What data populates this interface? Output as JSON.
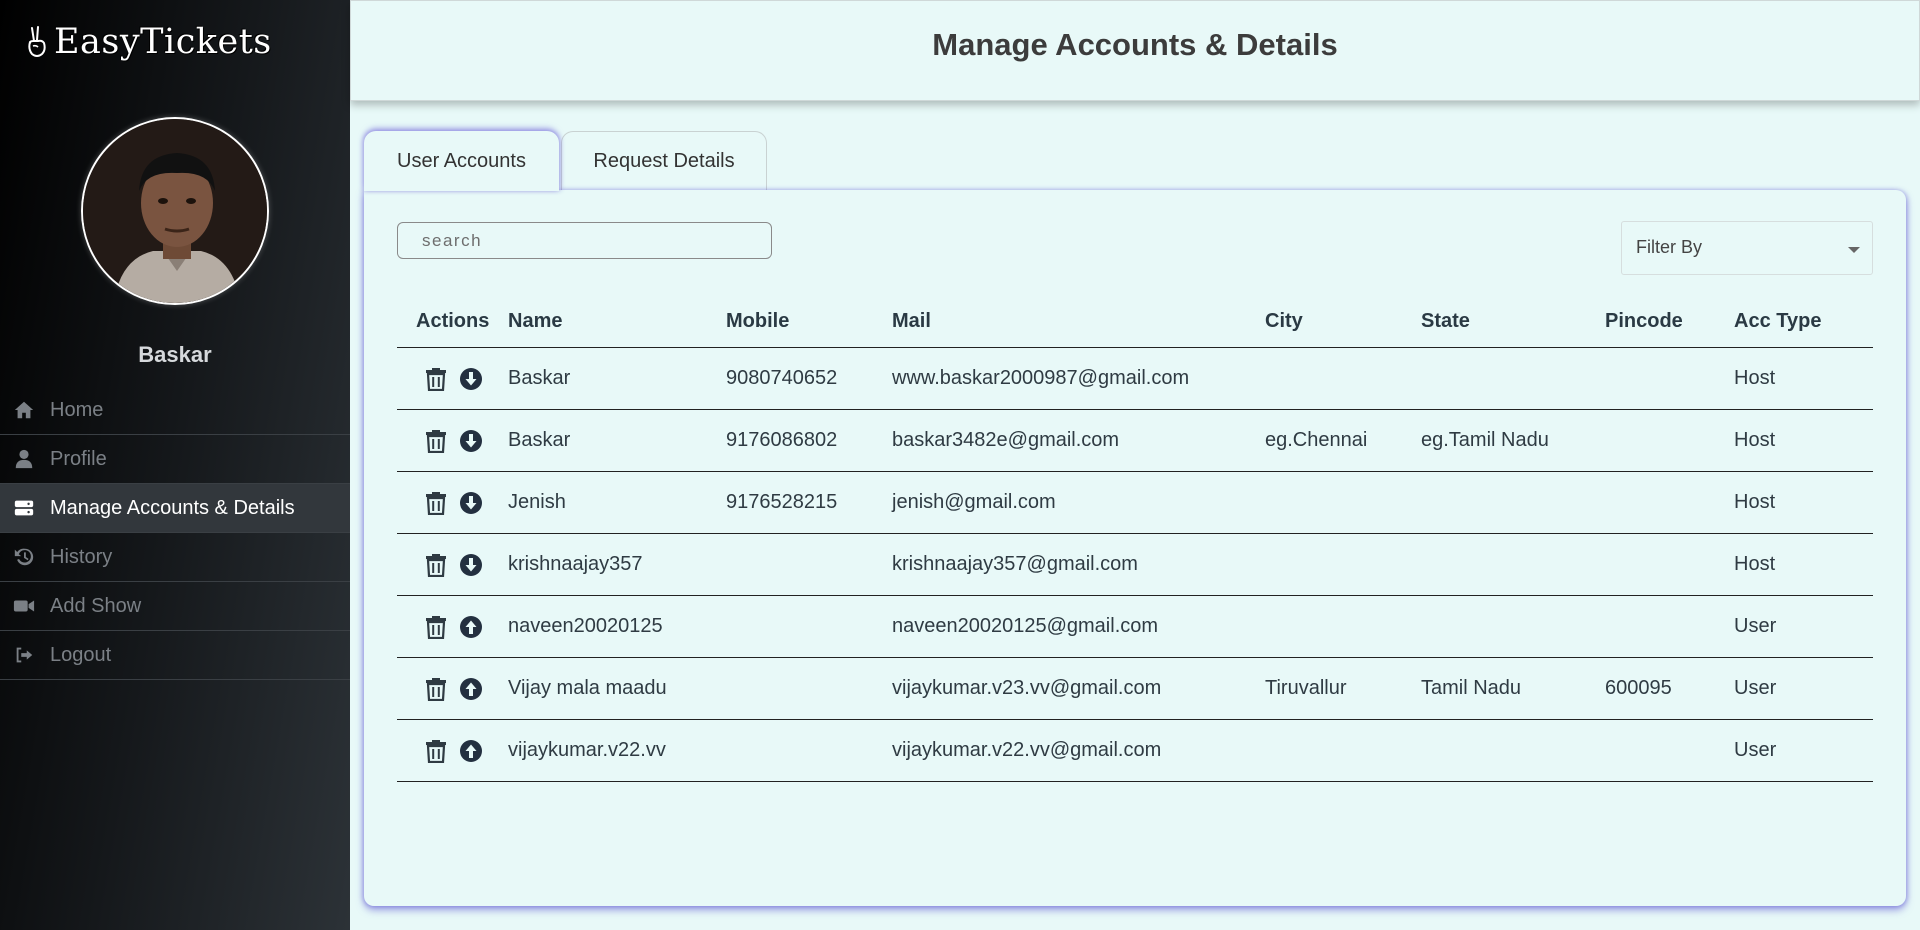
{
  "sidebar": {
    "brand": "EasyTickets",
    "username": "Baskar",
    "items": [
      {
        "label": "Home",
        "icon": "home-icon"
      },
      {
        "label": "Profile",
        "icon": "user-icon"
      },
      {
        "label": "Manage Accounts & Details",
        "icon": "server-icon",
        "active": true
      },
      {
        "label": "History",
        "icon": "history-icon"
      },
      {
        "label": "Add Show",
        "icon": "video-icon"
      },
      {
        "label": "Logout",
        "icon": "logout-icon"
      }
    ]
  },
  "header": {
    "title": "Manage Accounts & Details"
  },
  "tabs": [
    {
      "label": "User Accounts",
      "active": true
    },
    {
      "label": "Request Details",
      "active": false
    }
  ],
  "search": {
    "placeholder": "search",
    "value": ""
  },
  "filter": {
    "label": "Filter By"
  },
  "table": {
    "headers": [
      "Actions",
      "Name",
      "Mobile",
      "Mail",
      "City",
      "State",
      "Pincode",
      "Acc Type"
    ],
    "rows": [
      {
        "name": "Baskar",
        "mobile": "9080740652",
        "mail": "www.baskar2000987@gmail.com",
        "city": "",
        "state": "",
        "pincode": "",
        "acc_type": "Host",
        "action_icon": "arrow-down-circle-icon"
      },
      {
        "name": "Baskar",
        "mobile": "9176086802",
        "mail": "baskar3482e@gmail.com",
        "city": "eg.Chennai",
        "state": "eg.Tamil Nadu",
        "pincode": "",
        "acc_type": "Host",
        "action_icon": "arrow-down-circle-icon"
      },
      {
        "name": "Jenish",
        "mobile": "9176528215",
        "mail": "jenish@gmail.com",
        "city": "",
        "state": "",
        "pincode": "",
        "acc_type": "Host",
        "action_icon": "arrow-down-circle-icon"
      },
      {
        "name": "krishnaajay357",
        "mobile": "",
        "mail": "krishnaajay357@gmail.com",
        "city": "",
        "state": "",
        "pincode": "",
        "acc_type": "Host",
        "action_icon": "arrow-down-circle-icon"
      },
      {
        "name": "naveen20020125",
        "mobile": "",
        "mail": "naveen20020125@gmail.com",
        "city": "",
        "state": "",
        "pincode": "",
        "acc_type": "User",
        "action_icon": "arrow-up-circle-icon"
      },
      {
        "name": "Vijay mala maadu",
        "mobile": "",
        "mail": "vijaykumar.v23.vv@gmail.com",
        "city": "Tiruvallur",
        "state": "Tamil Nadu",
        "pincode": "600095",
        "acc_type": "User",
        "action_icon": "arrow-up-circle-icon"
      },
      {
        "name": "vijaykumar.v22.vv",
        "mobile": "",
        "mail": "vijaykumar.v22.vv@gmail.com",
        "city": "",
        "state": "",
        "pincode": "",
        "acc_type": "User",
        "action_icon": "arrow-up-circle-icon"
      }
    ]
  },
  "colors": {
    "sidebar_bg": "#15181b",
    "content_bg": "#e8f9f8",
    "panel_glow": "#5a50d2",
    "text_dark": "#2f3b43"
  }
}
